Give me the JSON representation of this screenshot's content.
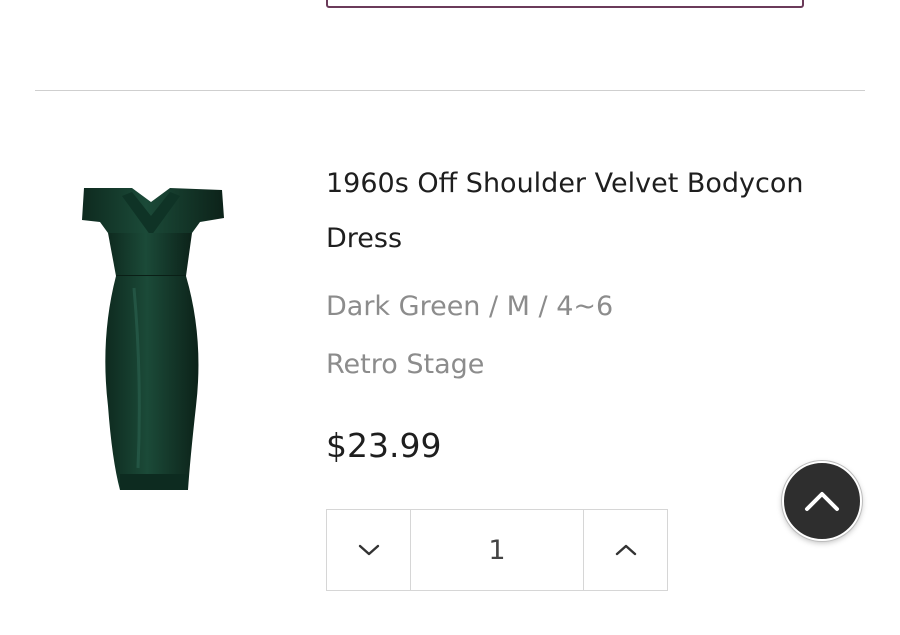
{
  "product": {
    "title": "1960s Off Shoulder Velvet Bodycon Dress",
    "variant": "Dark Green / M / 4~6",
    "vendor": "Retro Stage",
    "price": "$23.99",
    "image_icon": "dress-image",
    "image_color": "#163a2c"
  },
  "quantity": {
    "value": "1",
    "decrease_icon": "chevron-down-icon",
    "increase_icon": "chevron-up-icon"
  },
  "scroll_top": {
    "icon": "chevron-up-icon",
    "background": "#2e2e2e"
  },
  "colors": {
    "accent_border": "#6b3b5a",
    "text_primary": "#1e1e1e",
    "text_secondary": "#8c8c8c"
  }
}
